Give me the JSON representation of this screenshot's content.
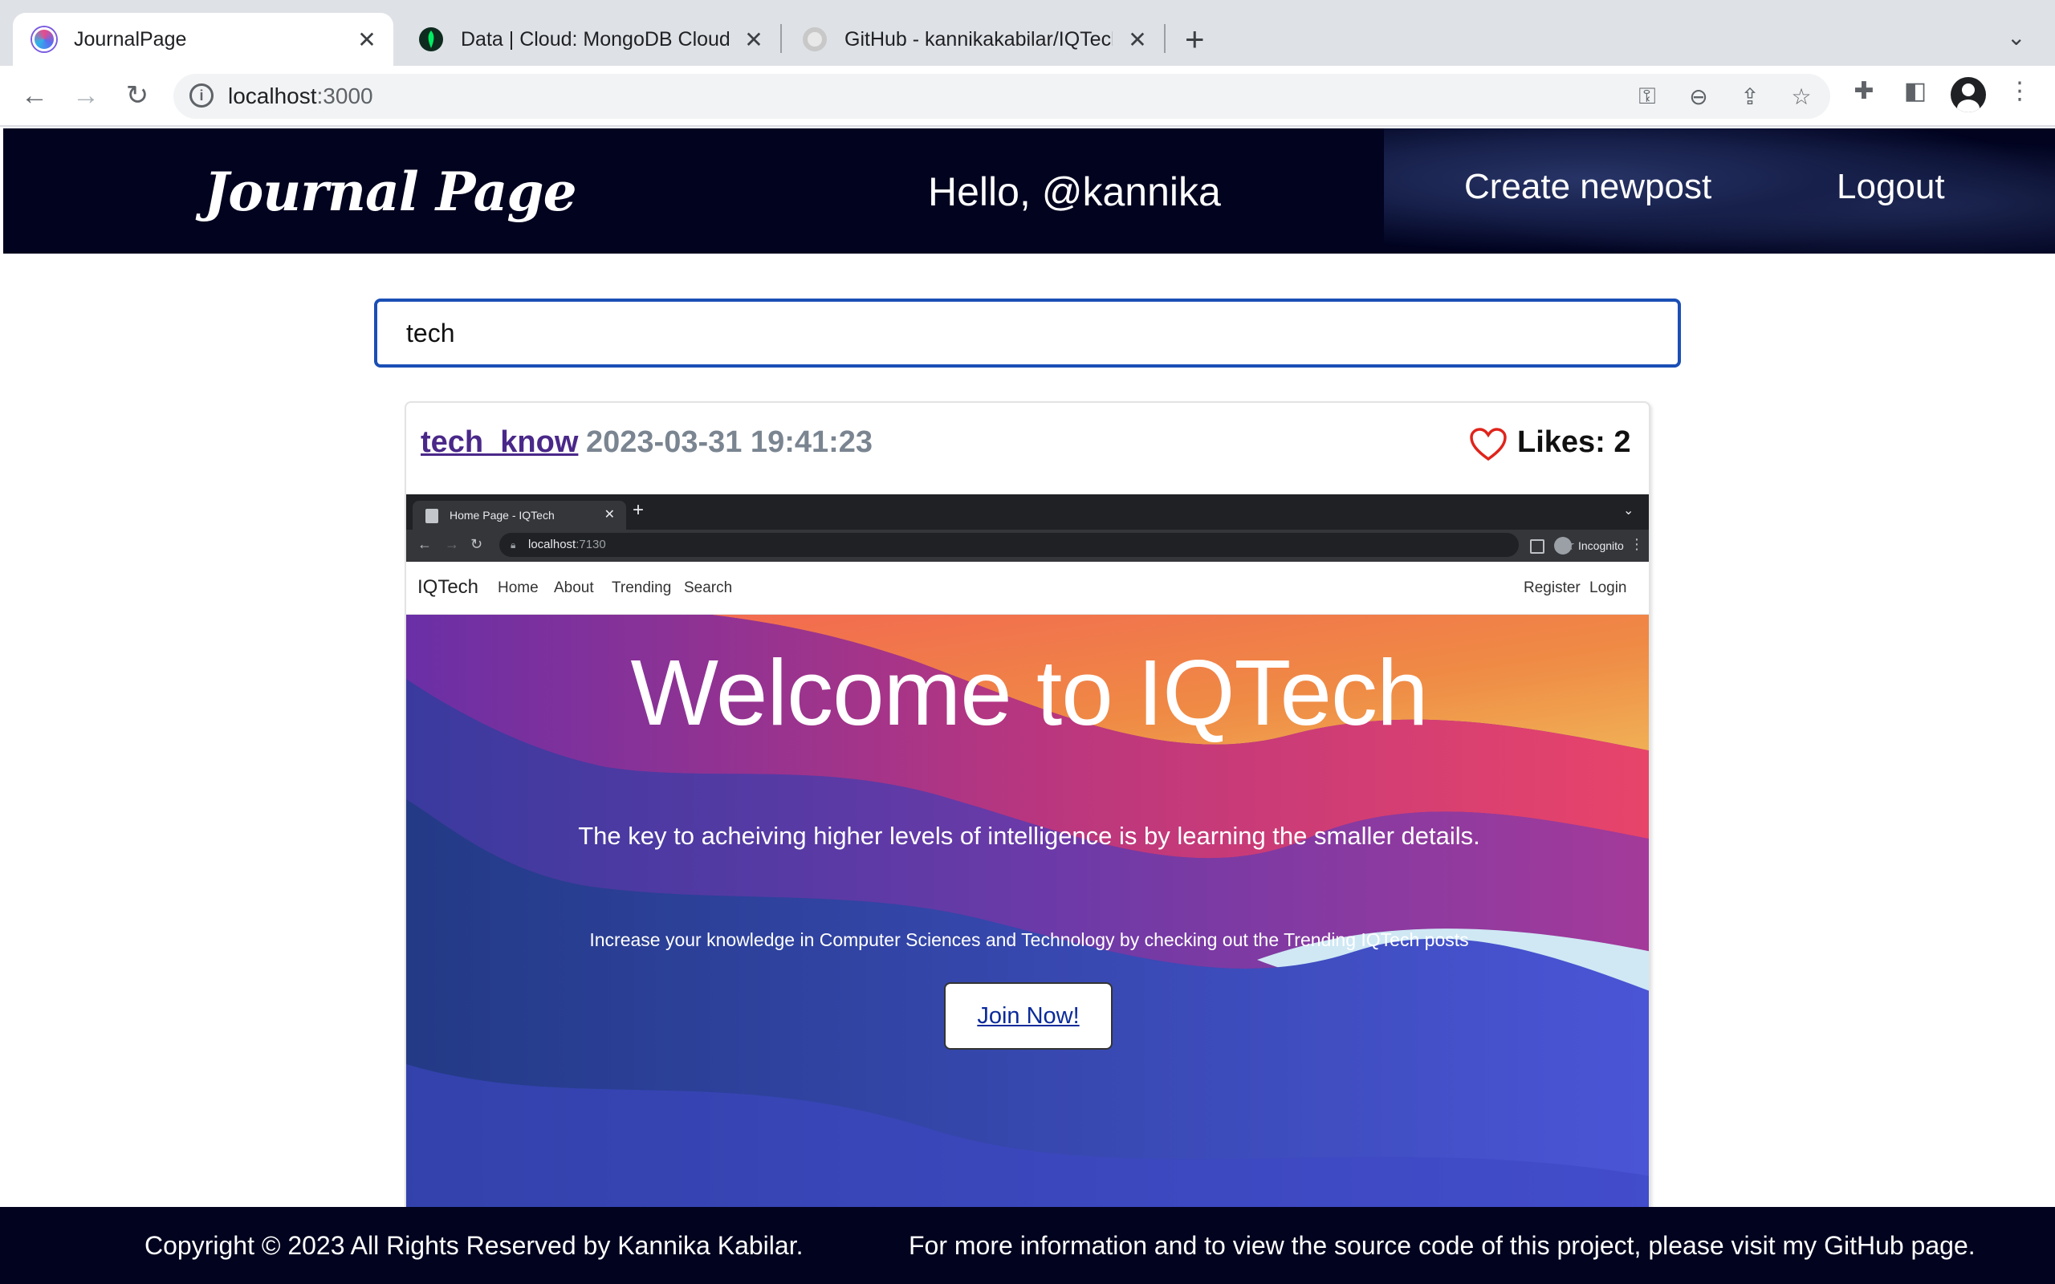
{
  "browser": {
    "tabs": [
      {
        "title": "JournalPage",
        "close": "✕"
      },
      {
        "title": "Data | Cloud: MongoDB Cloud",
        "close": "✕"
      },
      {
        "title": "GitHub - kannikakabilar/IQTech",
        "close": "✕"
      }
    ],
    "new_tab": "+",
    "tab_menu": "⌄",
    "url_host": "localhost",
    "url_port": ":3000",
    "icons": {
      "back": "arrow-left-icon",
      "forward": "arrow-right-icon",
      "reload": "reload-icon",
      "info": "info-icon",
      "key": "key-icon",
      "zoom": "zoom-out-icon",
      "share": "share-icon",
      "star": "star-icon",
      "extensions": "puzzle-icon",
      "sidepanel": "side-panel-icon",
      "profile": "profile-icon",
      "menu": "kebab-menu-icon"
    }
  },
  "header": {
    "logo": "Journal Page",
    "greeting": "Hello, @kannika",
    "create_link": "Create newpost",
    "logout_link": "Logout"
  },
  "search": {
    "value": "tech"
  },
  "post": {
    "username": "tech_know",
    "timestamp": "2023-03-31 19:41:23",
    "likes": "Likes: 2",
    "image": {
      "tab_title": "Home Page - IQTech",
      "tab_close": "✕",
      "new_tab": "+",
      "url_host": "localhost",
      "url_port": ":7130",
      "incognito": "Incognito",
      "nav": {
        "brand": "IQTech",
        "links": [
          "Home",
          "About",
          "Trending",
          "Search"
        ],
        "register": "Register",
        "login": "Login"
      },
      "hero": {
        "title": "Welcome to IQTech",
        "subtitle": "The key to acheiving higher levels of intelligence is by learning the smaller details.",
        "text": "Increase your knowledge in Computer Sciences and Technology by checking out the Trending IQTech posts",
        "button": "Join Now!"
      }
    }
  },
  "footer": {
    "copyright": "Copyright © 2023 All Rights Reserved by Kannika Kabilar.",
    "info": "For more information and to view the source code of this project, please visit my GitHub page."
  },
  "colors": {
    "header_bg": "#01031f",
    "search_border": "#1a4fb5",
    "username": "#4a2889",
    "heart": "#e0241b"
  }
}
